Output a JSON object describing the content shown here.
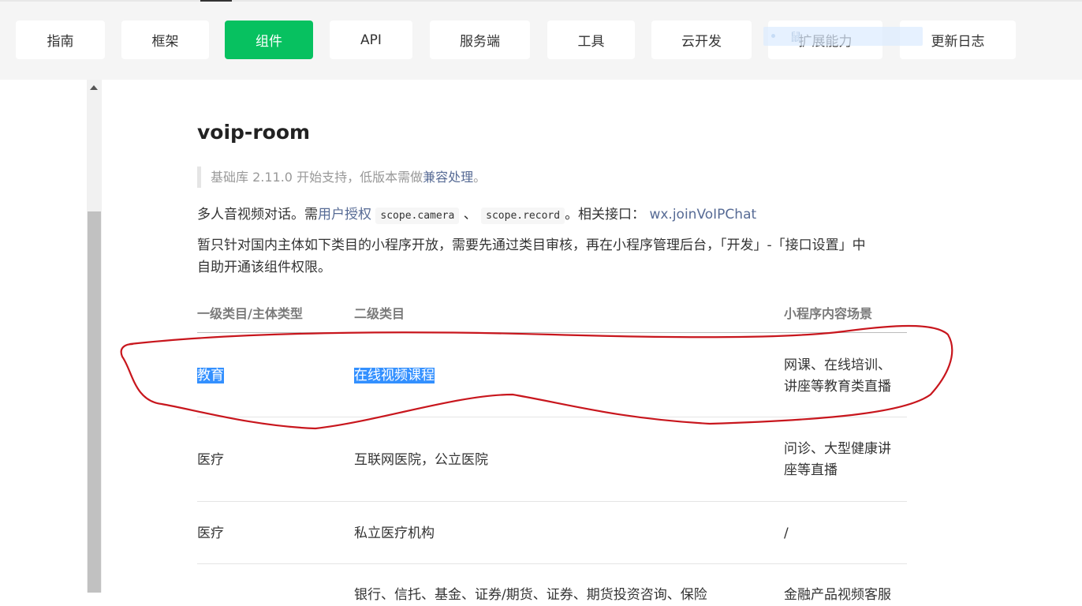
{
  "nav": {
    "items": [
      "指南",
      "框架",
      "组件",
      "API",
      "服务端",
      "工具",
      "云开发",
      "扩展能力",
      "更新日志"
    ],
    "active": "组件"
  },
  "floating_tip": {
    "text": "鼠"
  },
  "doc": {
    "title": "voip-room",
    "note": {
      "prefix": "基础库 2.11.0 开始支持，低版本需做",
      "link": "兼容处理",
      "suffix": "。"
    },
    "para1": {
      "t1": "多人音视频对话。需",
      "link1": "用户授权",
      "code1": "scope.camera",
      "sep": "、",
      "code2": "scope.record",
      "t2": "。相关接口：",
      "link2": "wx.joinVoIPChat"
    },
    "para2_line1": "暂只针对国内主体如下类目的小程序开放，需要先通过类目审核，再在小程序管理后台，「开发」-「接口设置」中",
    "para2_line2": "自助开通该组件权限。",
    "table": {
      "headers": [
        "一级类目/主体类型",
        "二级类目",
        "小程序内容场景"
      ],
      "rows": [
        {
          "c1": "教育",
          "c2": "在线视频课程",
          "c3_l1": "网课、在线培训、",
          "c3_l2": "讲座等教育类直播"
        },
        {
          "c1": "医疗",
          "c2": "互联网医院，公立医院",
          "c3_l1": "问诊、大型健康讲",
          "c3_l2": "座等直播"
        },
        {
          "c1": "医疗",
          "c2": "私立医疗机构",
          "c3_l1": "/",
          "c3_l2": ""
        },
        {
          "c1": "",
          "c2": "银行、信托、基金、证券/期货、证券、期货投资咨询、保险",
          "c3_l1": "金融产品视频客服",
          "c3_l2": ""
        }
      ]
    }
  },
  "colors": {
    "accent": "#07c160",
    "link": "#576b95",
    "selection": "#3390ff",
    "annotation": "#c8161d"
  }
}
